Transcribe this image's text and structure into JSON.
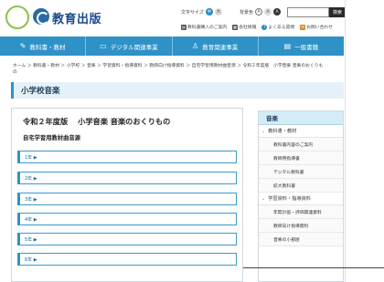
{
  "header": {
    "badge_text": "",
    "logo_text": "教育出版",
    "font_size_label": "文字サイズ",
    "font_size_options": [
      "中",
      "大"
    ],
    "bg_color_label": "背景色",
    "bg_color_options": [
      "A",
      "A",
      "A"
    ],
    "search_button": "検索",
    "util_links": [
      "教科書購入のご案内",
      "会社情報",
      "よくある質問",
      "お問い合わせ"
    ]
  },
  "nav": {
    "items": [
      {
        "icon": "✎",
        "label": "教科書・教材"
      },
      {
        "icon": "▭",
        "label": "デジタル関連事業"
      },
      {
        "icon": "♙",
        "label": "教育関連事業"
      },
      {
        "icon": "▤",
        "label": "一般書籍"
      }
    ]
  },
  "breadcrumb": "ホーム ＞ 教科書・教材 ＞ 小学校 ＞ 音楽 ＞ 学習資料・指導資料 ＞ 教師向け指導資料 ＞ 自宅学習用教材曲音源 ＞ 令和２年度版　小学音楽 音楽のおくりもの",
  "page_title": "小学校音楽",
  "main": {
    "title": "令和２年度版　 小学音楽 音楽のおくりもの",
    "subtitle": "自宅学習用教材曲音源",
    "grades": [
      "1年 ▶",
      "2年 ▶",
      "3年 ▶",
      "4年 ▶",
      "5年 ▶",
      "6年 ▶"
    ]
  },
  "sidebar": {
    "head": "音楽",
    "sections": [
      {
        "label": "教科書・教材",
        "links": [
          "教科書内容のご案内",
          "教師用指導書",
          "デジタル教科書",
          "拡大教科書"
        ]
      },
      {
        "label": "学習資料・指導資料",
        "links": [
          "年間計画・評価関連資料",
          "教師向け指導資料",
          "音楽の小部屋"
        ]
      }
    ]
  }
}
